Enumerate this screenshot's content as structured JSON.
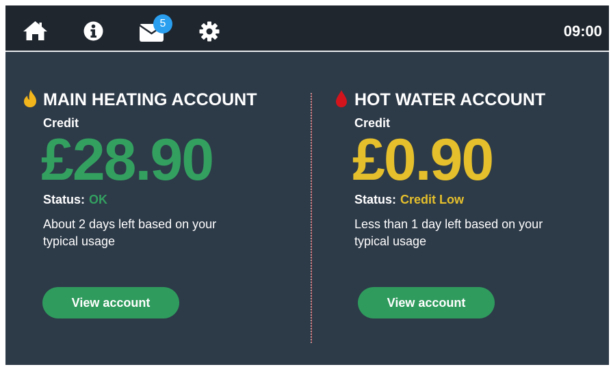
{
  "topbar": {
    "icons": [
      "home-icon",
      "info-icon",
      "mail-icon",
      "gear-icon"
    ],
    "notification_count": "5",
    "time": "09:00"
  },
  "accounts": [
    {
      "icon": "flame-icon",
      "title": "MAIN HEATING ACCOUNT",
      "credit_label": "Credit",
      "credit_value": "£28.90",
      "status_label": "Status:",
      "status_value": "OK",
      "description": "About 2 days left based on your typical usage",
      "button_label": "View account"
    },
    {
      "icon": "water-drop-icon",
      "title": "HOT WATER ACCOUNT",
      "credit_label": "Credit",
      "credit_value": "£0.90",
      "status_label": "Status:",
      "status_value": "Credit Low",
      "description": "Less than 1 day left based on your typical usage",
      "button_label": "View account"
    }
  ],
  "colors": {
    "background": "#2d3a48",
    "topbar": "#1f262e",
    "ok_green": "#33a060",
    "low_yellow": "#e5c02c",
    "button_green": "#2f9b5d",
    "badge_blue": "#2a9ff0",
    "flame_yellow": "#f2b51b",
    "drop_red": "#d4141c"
  }
}
